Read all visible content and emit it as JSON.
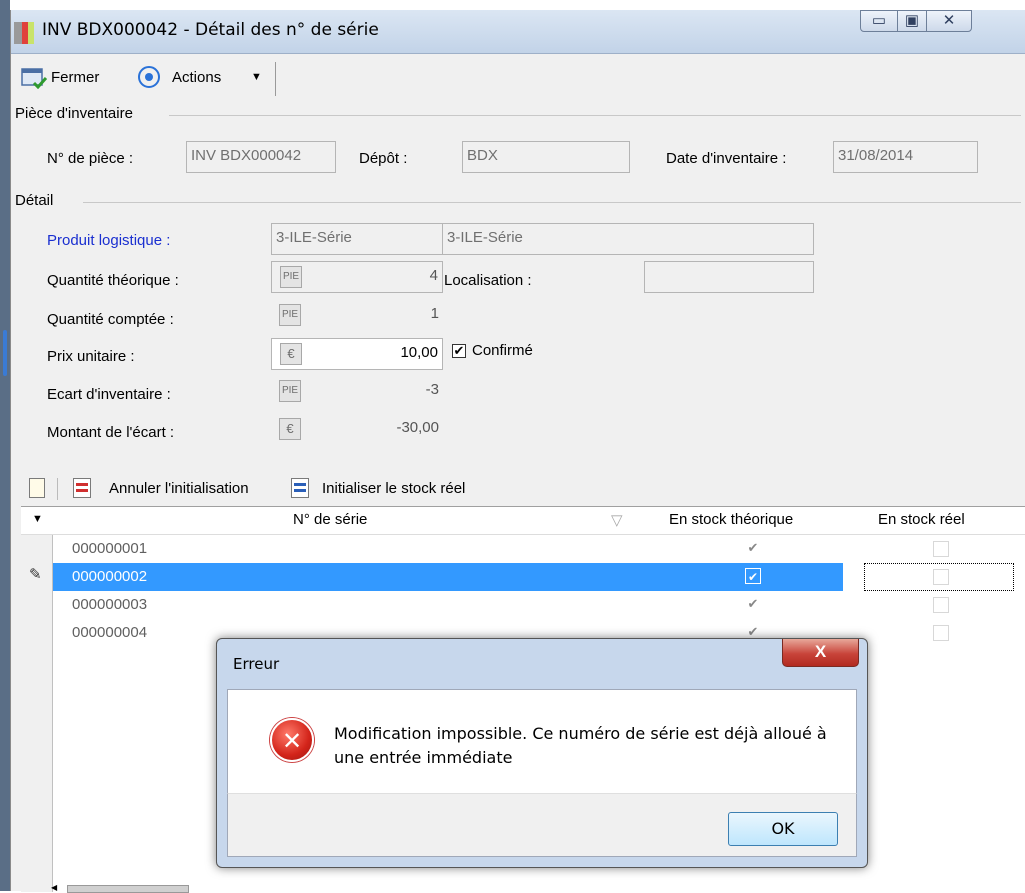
{
  "window": {
    "title": "INV BDX000042 -  Détail des n° de série",
    "min_glyph": "▭",
    "max_glyph": "▣",
    "close_glyph": "✕"
  },
  "toolbar": {
    "fermer_label": "Fermer",
    "actions_label": "Actions",
    "actions_caret": "▼"
  },
  "piece": {
    "group_label": "Pièce d'inventaire",
    "numero_label": "N° de pièce :",
    "numero_value": "INV BDX000042",
    "depot_label": "Dépôt :",
    "depot_value": "BDX",
    "date_label": "Date d'inventaire :",
    "date_value": "31/08/2014"
  },
  "detail": {
    "group_label": "Détail",
    "produit_label": "Produit logistique :",
    "produit_code": "3-ILE-Série",
    "produit_desc": "3-ILE-Série",
    "qte_theo_label": "Quantité théorique :",
    "qte_theo_unit": "PIE",
    "qte_theo_value": "4",
    "localisation_label": "Localisation :",
    "localisation_value": "",
    "qte_comptee_label": "Quantité comptée :",
    "qte_comptee_unit": "PIE",
    "qte_comptee_value": "1",
    "prix_label": "Prix unitaire :",
    "prix_unit": "€",
    "prix_value": "10,00",
    "confirme_label": "Confirmé",
    "confirme_checked": true,
    "ecart_label": "Ecart d'inventaire :",
    "ecart_unit": "PIE",
    "ecart_value": "-3",
    "montant_label": "Montant de l'écart :",
    "montant_unit": "€",
    "montant_value": "-30,00"
  },
  "grid_toolbar": {
    "annuler_label": "Annuler l'initialisation",
    "initialiser_label": "Initialiser le stock réel"
  },
  "grid": {
    "col_serie": "N° de série",
    "col_theorique": "En stock théorique",
    "col_reel": "En stock réel",
    "rows": [
      {
        "serie": "000000001",
        "theorique": true,
        "reel": false
      },
      {
        "serie": "000000002",
        "theorique": true,
        "reel": false
      },
      {
        "serie": "000000003",
        "theorique": true,
        "reel": false
      },
      {
        "serie": "000000004",
        "theorique": true,
        "reel": false
      }
    ],
    "selected_index": 1
  },
  "dialog": {
    "title": "Erreur",
    "close_glyph": "X",
    "message": "Modification impossible. Ce numéro de série est déjà alloué à une entrée immédiate",
    "ok_label": "OK",
    "error_glyph": "✕"
  }
}
